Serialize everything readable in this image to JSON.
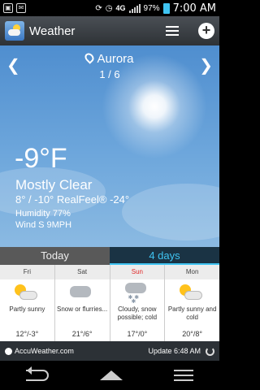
{
  "status_bar": {
    "network": "4G",
    "battery": "97%",
    "time": "7:00 AM",
    "icons": [
      "photo-icon",
      "mail-icon",
      "sync-icon",
      "alarm-icon",
      "signal-icon",
      "battery-icon"
    ]
  },
  "app": {
    "title": "Weather",
    "icons": [
      "weather-app-logo-icon",
      "list-icon",
      "add-icon"
    ]
  },
  "location": {
    "city": "Aurora",
    "page_indicator": "1 / 6"
  },
  "current": {
    "temperature": "-9°F",
    "condition": "Mostly Clear",
    "hi_lo_realfeel": "8° / -10°   RealFeel® -24°",
    "humidity": "Humidity 77%",
    "wind": "Wind S 9MPH"
  },
  "tabs": [
    {
      "label": "Today",
      "selected": false
    },
    {
      "label": "4 days",
      "selected": true
    }
  ],
  "forecast": [
    {
      "day": "Fri",
      "condition": "Partly sunny",
      "temps": "12°/-3°",
      "icon": "partly-sunny-icon"
    },
    {
      "day": "Sat",
      "condition": "Snow or flurries...",
      "temps": "21°/6°",
      "icon": "cloudy-icon"
    },
    {
      "day": "Sun",
      "condition": "Cloudy, snow possible; cold",
      "temps": "17°/0°",
      "icon": "snow-cloud-icon"
    },
    {
      "day": "Mon",
      "condition": "Partly sunny and cold",
      "temps": "20°/8°",
      "icon": "partly-sunny-icon"
    }
  ],
  "footer": {
    "brand": "AccuWeather.com",
    "update": "Update 6:48 AM"
  },
  "colors": {
    "accent": "#3fc4f2",
    "sunday": "#e02a2a",
    "sky_top": "#4f8ecf"
  }
}
